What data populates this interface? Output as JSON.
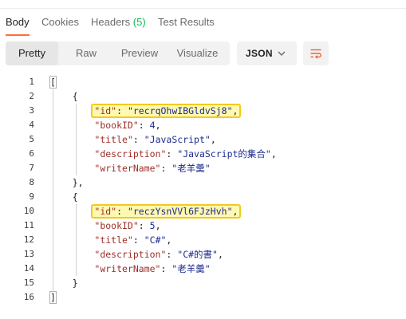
{
  "tabs": [
    {
      "label": "Body"
    },
    {
      "label": "Cookies"
    },
    {
      "label": "Headers",
      "count": "(5)"
    },
    {
      "label": "Test Results"
    }
  ],
  "view_modes": [
    "Pretty",
    "Raw",
    "Preview",
    "Visualize"
  ],
  "active_view_mode": "Pretty",
  "format": {
    "selected": "JSON"
  },
  "icons": {
    "format_dropdown": "chevron-down-icon",
    "wrap": "wrap-lines-icon"
  },
  "colors": {
    "accent": "#ff6c37",
    "count": "#0cbb52",
    "highlight": "#f0cc1c"
  },
  "code": {
    "line_numbers": [
      "1",
      "2",
      "3",
      "4",
      "5",
      "6",
      "7",
      "8",
      "9",
      "10",
      "11",
      "12",
      "13",
      "14",
      "15",
      "16"
    ],
    "records": [
      {
        "id_key": "\"id\"",
        "id_val": "\"recrqOhwIBGldvSj8\"",
        "bookID_key": "\"bookID\"",
        "bookID_val": "4",
        "title_key": "\"title\"",
        "title_val": "\"JavaScript\"",
        "description_key": "\"description\"",
        "description_val": "\"JavaScript的集合\"",
        "writerName_key": "\"writerName\"",
        "writerName_val": "\"老羊羹\""
      },
      {
        "id_key": "\"id\"",
        "id_val": "\"reczYsnVVl6FJzHvh\"",
        "bookID_key": "\"bookID\"",
        "bookID_val": "5",
        "title_key": "\"title\"",
        "title_val": "\"C#\"",
        "description_key": "\"description\"",
        "description_val": "\"C#的書\"",
        "writerName_key": "\"writerName\"",
        "writerName_val": "\"老羊羹\""
      }
    ]
  }
}
